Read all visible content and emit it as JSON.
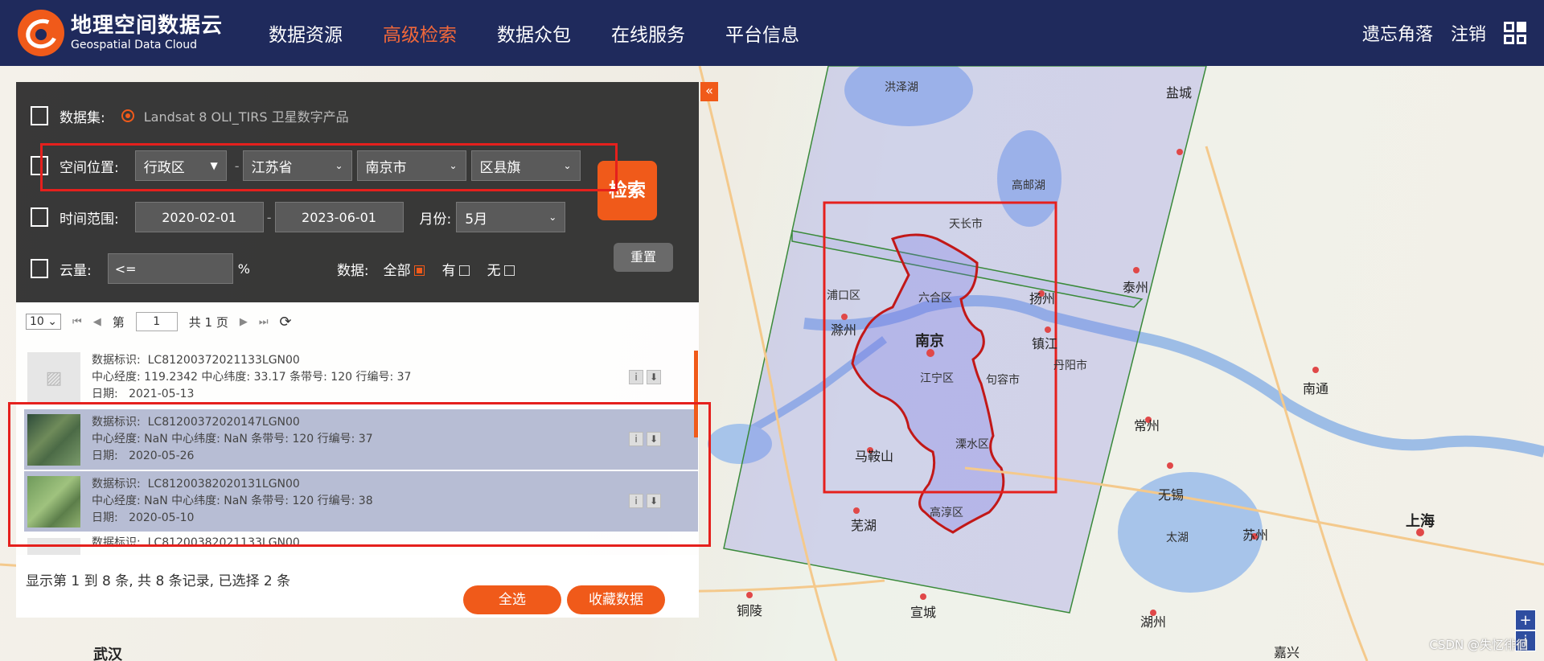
{
  "header": {
    "logo_cn": "地理空间数据云",
    "logo_en": "Geospatial Data Cloud",
    "nav": [
      "数据资源",
      "高级检索",
      "数据众包",
      "在线服务",
      "平台信息"
    ],
    "active_nav": "高级检索",
    "user": "遗忘角落",
    "logout": "注销"
  },
  "search": {
    "dataset_label": "数据集:",
    "dataset_value": "Landsat 8 OLI_TIRS 卫星数字产品",
    "location_label": "空间位置:",
    "location_type": "行政区",
    "province": "江苏省",
    "city": "南京市",
    "district": "区县旗",
    "time_label": "时间范围:",
    "start_date": "2020-02-01",
    "end_date": "2023-06-01",
    "month_label": "月份:",
    "month": "5月",
    "cloud_label": "云量:",
    "cloud_op": "<=",
    "cloud_unit": "%",
    "data_label": "数据:",
    "opt_all": "全部",
    "opt_have": "有",
    "opt_none": "无",
    "search_btn": "检索",
    "reset_btn": "重置",
    "collapse": "«"
  },
  "pager": {
    "page_size": "10",
    "page_prefix": "第",
    "page": "1",
    "page_suffix": "共 1 页"
  },
  "results": [
    {
      "id_label": "数据标识:",
      "id": "LC81200372021133LGN00",
      "line2": "中心经度:  119.2342 中心纬度:    33.17 条带号: 120 行编号: 37",
      "date_label": "日期:",
      "date": "2021-05-13"
    },
    {
      "id_label": "数据标识:",
      "id": "LC81200372020147LGN00",
      "line2": "中心经度:  NaN 中心纬度:   NaN 条带号: 120 行编号: 37",
      "date_label": "日期:",
      "date": "2020-05-26"
    },
    {
      "id_label": "数据标识:",
      "id": "LC81200382020131LGN00",
      "line2": "中心经度:  NaN 中心纬度:   NaN 条带号: 120 行编号: 38",
      "date_label": "日期:",
      "date": "2020-05-10"
    },
    {
      "id_label": "数据标识:",
      "id": "LC81200382021133LGN00",
      "line2": "",
      "date_label": "",
      "date": ""
    }
  ],
  "status": {
    "summary": "显示第 1 到 8 条, 共 8 条记录, 已选择 2 条",
    "select_all": "全选",
    "favorite": "收藏数据"
  },
  "map": {
    "labels": {
      "nanjing": "南京",
      "chuzhou": "滁州",
      "maanshan": "马鞍山",
      "wuhu": "芜湖",
      "zhenjiang": "镇江",
      "yangzhou": "扬州",
      "changzhou": "常州",
      "wuxi": "无锡",
      "suzhou": "苏州",
      "shanghai": "上海",
      "nantong": "南通",
      "taizhou": "泰州",
      "yancheng": "盐城",
      "xuancheng": "宣城",
      "huzhou": "湖州",
      "tongling": "铜陵",
      "jiaxing": "嘉兴",
      "wuhan": "武汉",
      "taihu": "太湖",
      "hongze": "洪泽湖",
      "gaoyou": "高邮湖",
      "jiangning": "江宁区",
      "lishui": "溧水区",
      "gaochun": "高淳区",
      "liuhe": "六合区",
      "pukou": "浦口区",
      "tianchang": "天长市",
      "jurong": "句容市",
      "danyang": "丹阳市"
    },
    "watermark": "CSDN @失忆徘徊"
  }
}
